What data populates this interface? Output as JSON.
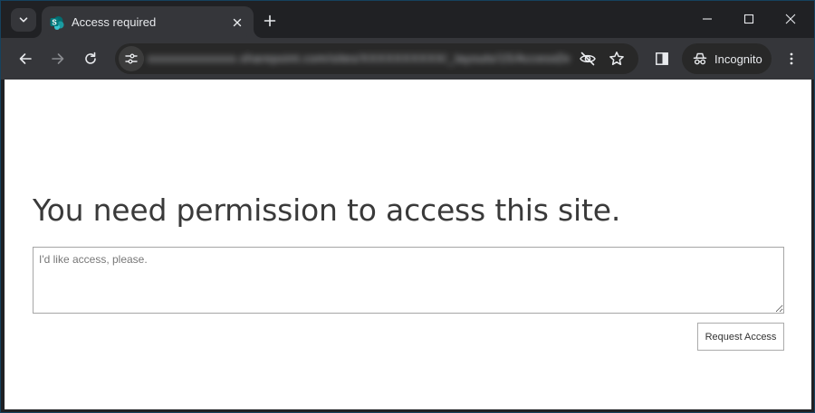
{
  "browser": {
    "tab": {
      "title": "Access required",
      "favicon": "sharepoint-icon"
    },
    "address_bar": {
      "url": "xxxxxxxxxxxxxx.sharepoint.com/sites/XXXXXXXXXX/_layouts/15/AccessDenied.aspx?Source=XXXXXXXXXX"
    },
    "incognito_label": "Incognito",
    "colors": {
      "frame": "#202124",
      "toolbar": "#35363a",
      "omnibox": "#282828",
      "text": "#e8eaed"
    }
  },
  "page": {
    "heading": "You need permission to access this site.",
    "message_placeholder": "I'd like access, please.",
    "request_button": "Request Access"
  }
}
